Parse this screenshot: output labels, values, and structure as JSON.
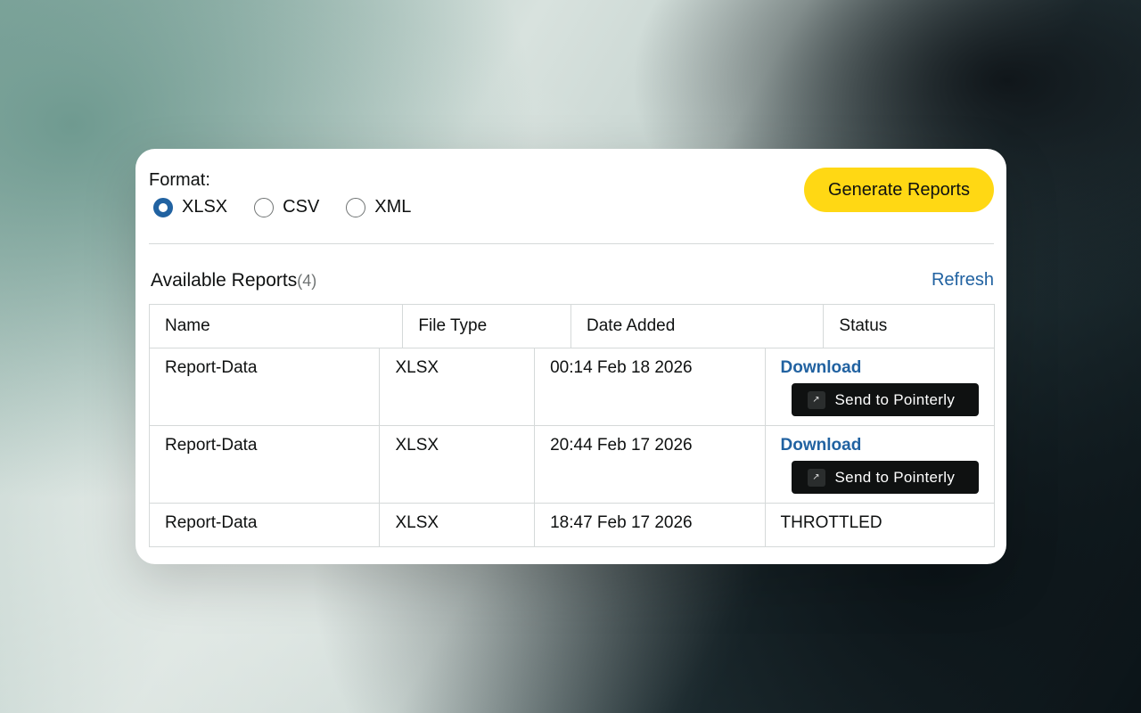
{
  "format": {
    "label": "Format:",
    "options": [
      {
        "label": "XLSX",
        "selected": true
      },
      {
        "label": "CSV",
        "selected": false
      },
      {
        "label": "XML",
        "selected": false
      }
    ]
  },
  "generate_button": "Generate Reports",
  "reports": {
    "title": "Available Reports",
    "count": "(4)",
    "refresh": "Refresh",
    "columns": [
      "Name",
      "File Type",
      "Date Added",
      "Status"
    ],
    "rows": [
      {
        "name": "Report-Data",
        "type": "XLSX",
        "date": "00:14 Feb 18 2026",
        "status": "",
        "download": "Download",
        "send": "Send to Pointerly"
      },
      {
        "name": "Report-Data",
        "type": "XLSX",
        "date": "20:44 Feb 17 2026",
        "status": "",
        "download": "Download",
        "send": "Send to Pointerly"
      },
      {
        "name": "Report-Data",
        "type": "XLSX",
        "date": "18:47 Feb 17 2026",
        "status": "THROTTLED",
        "download": "",
        "send": ""
      }
    ]
  },
  "colors": {
    "accent": "#2162a1",
    "button_yellow": "#ffd814",
    "send_button": "#0f1111"
  },
  "icons": {
    "pointerly_logo": "pointerly-logo-icon",
    "radio": "radio-icon"
  }
}
